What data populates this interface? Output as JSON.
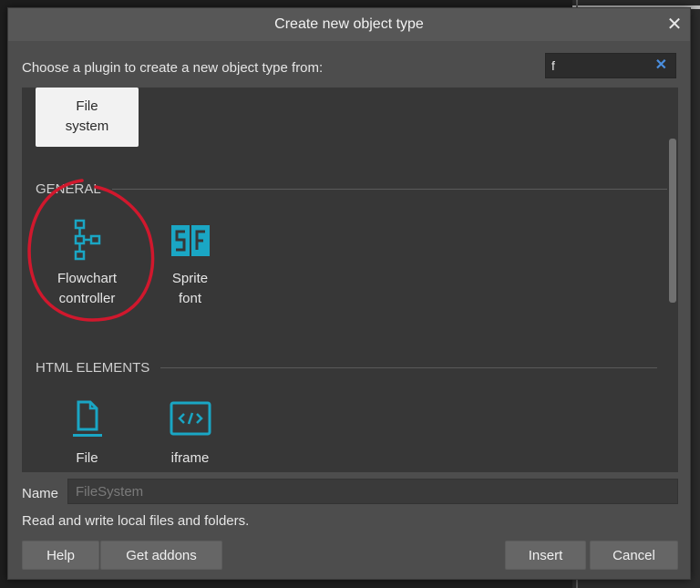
{
  "dialog": {
    "title": "Create new object type",
    "prompt": "Choose a plugin to create a new object type from:",
    "search": {
      "value": "f"
    },
    "name": {
      "label": "Name",
      "placeholder": "FileSystem"
    },
    "description": "Read and write local files and folders.",
    "buttons": {
      "help": "Help",
      "addons": "Get addons",
      "insert": "Insert",
      "cancel": "Cancel"
    }
  },
  "selected_item": {
    "line1": "File",
    "line2": "system"
  },
  "sections": {
    "general": {
      "title": "GENERAL",
      "items": [
        {
          "line1": "Flowchart",
          "line2": "controller",
          "icon": "flowchart-icon"
        },
        {
          "line1": "Sprite",
          "line2": "font",
          "icon": "sprite-font-icon"
        }
      ]
    },
    "html_elements": {
      "title": "HTML ELEMENTS",
      "items": [
        {
          "line1": "File",
          "icon": "file-icon"
        },
        {
          "line1": "iframe",
          "icon": "iframe-icon"
        }
      ]
    }
  },
  "colors": {
    "icon_teal": "#1aa6c4",
    "annotation_red": "#d0182d",
    "accent_blue": "#4a8ede"
  }
}
